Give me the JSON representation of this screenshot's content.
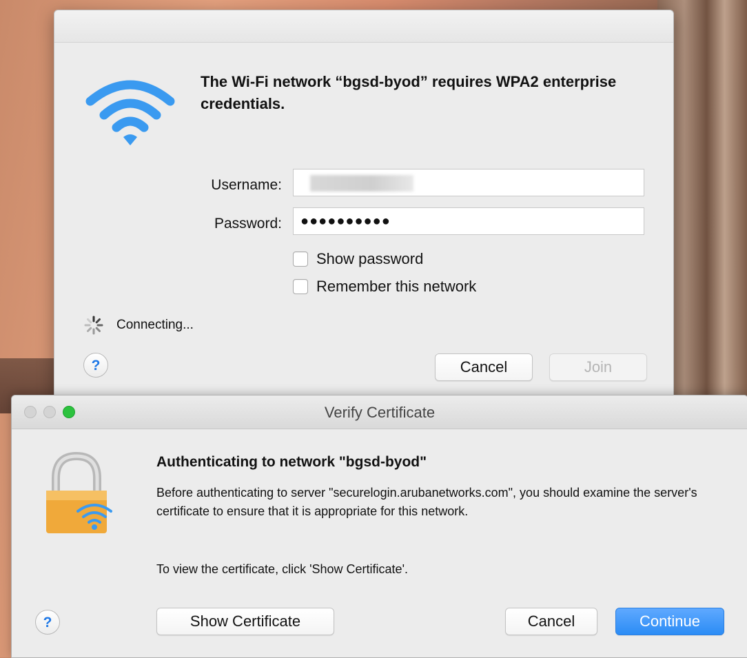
{
  "wifi_dialog": {
    "title": "The Wi-Fi network “bgsd-byod” requires WPA2 enterprise credentials.",
    "username_label": "Username:",
    "username_value": "",
    "password_label": "Password:",
    "password_value": "●●●●●●●●●●",
    "show_password_label": "Show password",
    "remember_network_label": "Remember this network",
    "status_text": "Connecting...",
    "help_label": "?",
    "cancel_label": "Cancel",
    "join_label": "Join",
    "icons": [
      "wifi-icon",
      "spinner-icon"
    ]
  },
  "cert_window": {
    "window_title": "Verify Certificate",
    "heading": "Authenticating to network \"bgsd-byod\"",
    "body": "Before authenticating to server \"securelogin.arubanetworks.com\", you should examine the server's certificate to ensure that it is appropriate for this network.",
    "hint": "To view the certificate, click 'Show Certificate'.",
    "help_label": "?",
    "show_certificate_label": "Show Certificate",
    "cancel_label": "Cancel",
    "continue_label": "Continue",
    "icons": [
      "lock-wifi-icon"
    ]
  },
  "colors": {
    "accent_blue": "#2b8cf5",
    "wifi_blue": "#3a9af0",
    "lock_gold": "#f0a93a",
    "zoom_green": "#2cc23e"
  }
}
